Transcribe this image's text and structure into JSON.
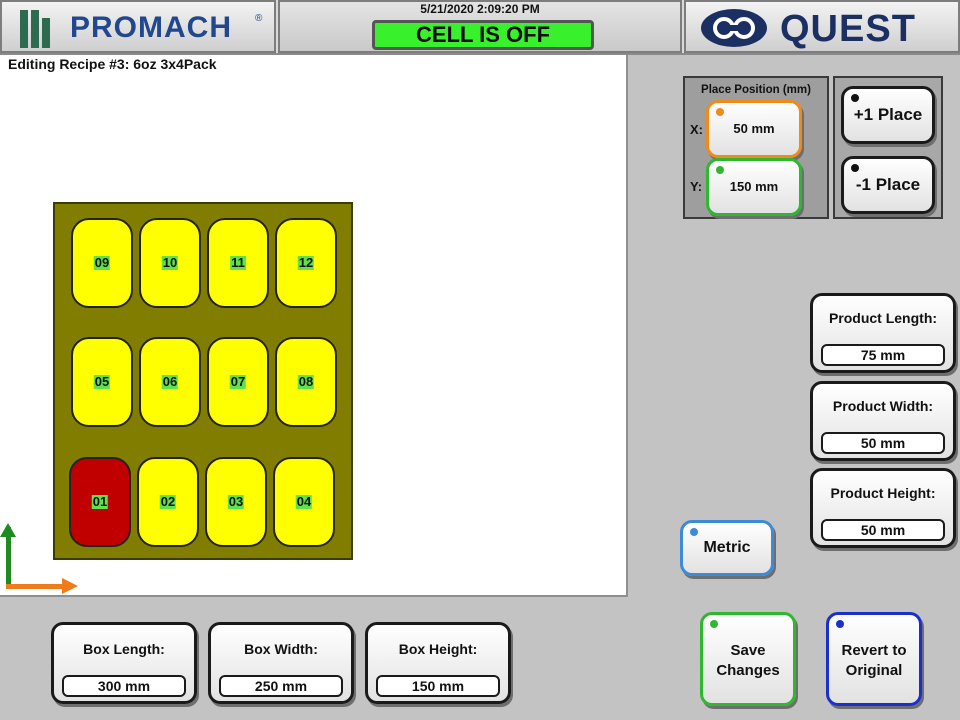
{
  "header": {
    "brand_left": "PROMACH",
    "brand_left_tm": "®",
    "datetime": "5/21/2020 2:09:20 PM",
    "cell_status": "CELL IS OFF",
    "brand_right": "QUEST",
    "colors": {
      "cell_status_bg": "#38f02c",
      "promach_text": "#21478f",
      "quest_text": "#1c2f63"
    }
  },
  "canvas": {
    "recipe_title": "Editing Recipe #3: 6oz 3x4Pack",
    "cells": [
      {
        "label": "09",
        "active": false
      },
      {
        "label": "10",
        "active": false
      },
      {
        "label": "11",
        "active": false
      },
      {
        "label": "12",
        "active": false
      },
      {
        "label": "05",
        "active": false
      },
      {
        "label": "06",
        "active": false
      },
      {
        "label": "07",
        "active": false
      },
      {
        "label": "08",
        "active": false
      },
      {
        "label": "01",
        "active": true
      },
      {
        "label": "02",
        "active": false
      },
      {
        "label": "03",
        "active": false
      },
      {
        "label": "04",
        "active": false
      }
    ],
    "colors": {
      "box": "#807d00",
      "cell": "#ffff00",
      "cell_active": "#c00000",
      "axis_y": "#1f8a1f",
      "axis_x": "#f07b1b"
    }
  },
  "place_position": {
    "title": "Place Position (mm)",
    "x_label": "X:",
    "x_value": "50 mm",
    "y_label": "Y:",
    "y_value": "150 mm",
    "plus_label": "+1 Place",
    "minus_label": "-1 Place"
  },
  "product": {
    "length_label": "Product Length:",
    "length_value": "75 mm",
    "width_label": "Product Width:",
    "width_value": "50 mm",
    "height_label": "Product Height:",
    "height_value": "50 mm"
  },
  "units_button": "Metric",
  "box": {
    "length_label": "Box Length:",
    "length_value": "300 mm",
    "width_label": "Box Width:",
    "width_value": "250 mm",
    "height_label": "Box Height:",
    "height_value": "150 mm"
  },
  "actions": {
    "save_line1": "Save",
    "save_line2": "Changes",
    "revert_line1": "Revert to",
    "revert_line2": "Original"
  },
  "icons": [
    "promach-logo-icon",
    "quest-logo-icon",
    "axis-arrow-icon",
    "indicator-light-icon"
  ]
}
